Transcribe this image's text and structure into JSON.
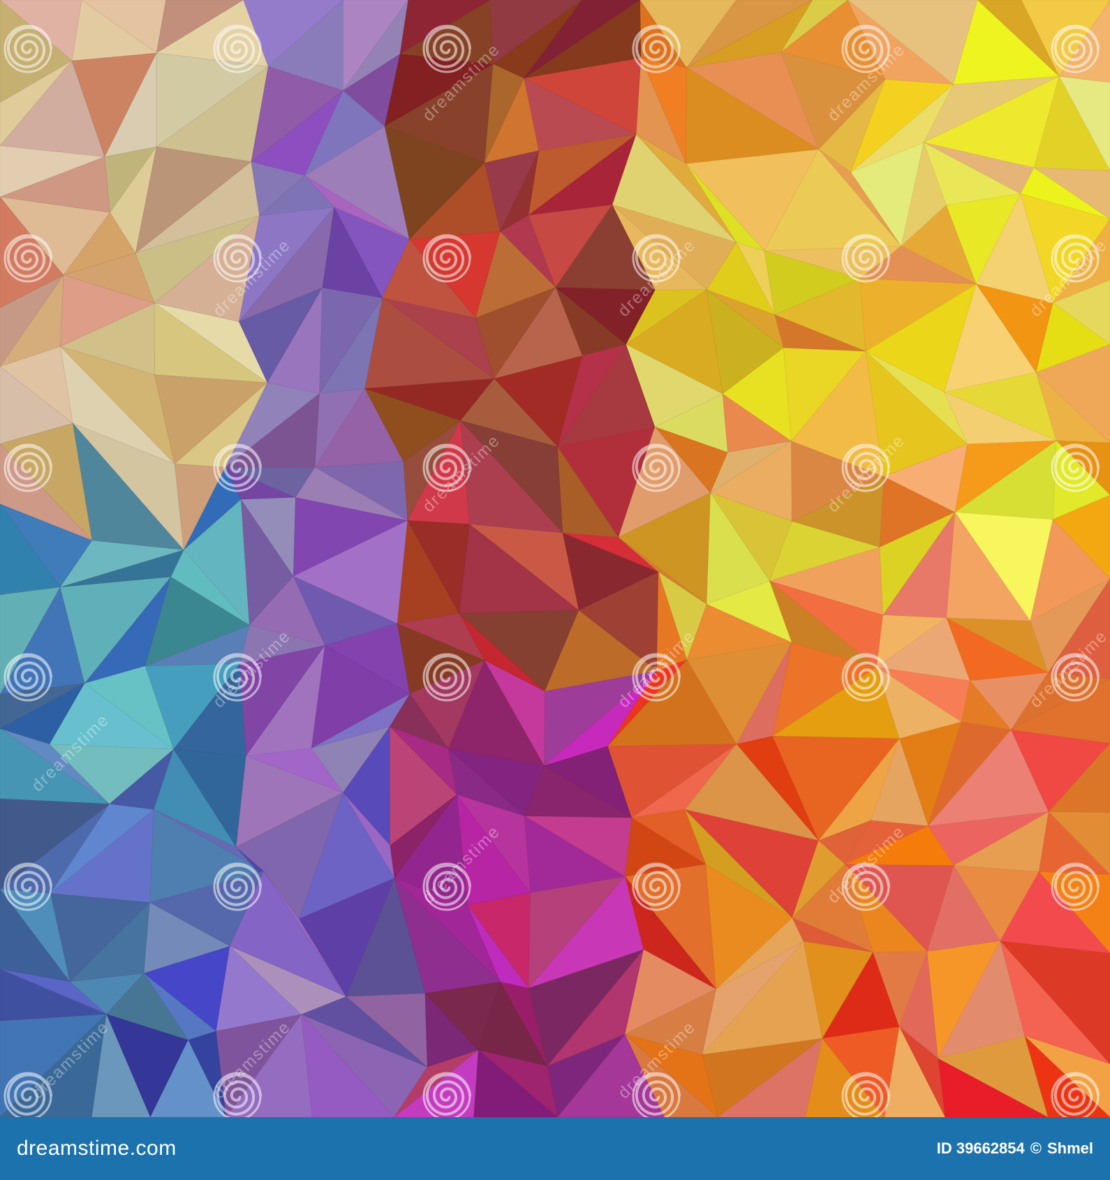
{
  "image": {
    "description_colors": [
      "#5a3a6e",
      "#c8452a",
      "#f0a030",
      "#e8c870",
      "#3f6fa8",
      "#7a5aa8",
      "#e86a20"
    ]
  },
  "watermark": {
    "text": "dreamstime"
  },
  "footer": {
    "brand": "dreamstime.com",
    "id_label": "ID 39662854",
    "separator": "©",
    "author": "Shmel",
    "background_color": "#1b72ad"
  }
}
